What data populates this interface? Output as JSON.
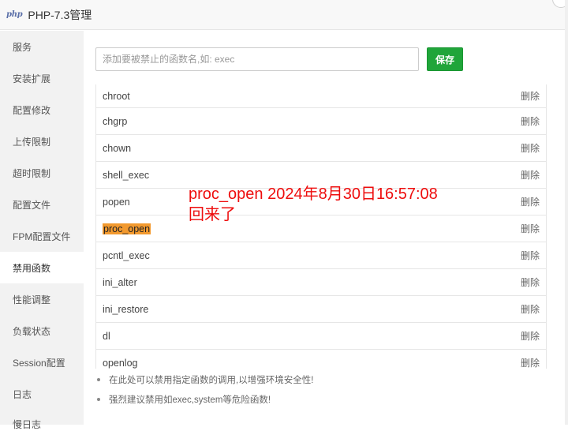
{
  "window": {
    "logo": "php",
    "title": "PHP-7.3管理"
  },
  "sidebar": {
    "items": [
      {
        "label": "服务"
      },
      {
        "label": "安装扩展"
      },
      {
        "label": "配置修改"
      },
      {
        "label": "上传限制"
      },
      {
        "label": "超时限制"
      },
      {
        "label": "配置文件"
      },
      {
        "label": "FPM配置文件"
      },
      {
        "label": "禁用函数",
        "active": true
      },
      {
        "label": "性能调整"
      },
      {
        "label": "负载状态"
      },
      {
        "label": "Session配置"
      },
      {
        "label": "日志"
      },
      {
        "label": "慢日志"
      }
    ]
  },
  "form": {
    "placeholder": "添加要被禁止的函数名,如: exec",
    "value": "",
    "save_label": "保存"
  },
  "functions": {
    "delete_label": "删除",
    "rows": [
      {
        "name": "chroot"
      },
      {
        "name": "chgrp"
      },
      {
        "name": "chown"
      },
      {
        "name": "shell_exec"
      },
      {
        "name": "popen"
      },
      {
        "name": "proc_open",
        "highlighted": true
      },
      {
        "name": "pcntl_exec"
      },
      {
        "name": "ini_alter"
      },
      {
        "name": "ini_restore"
      },
      {
        "name": "dl"
      },
      {
        "name": "openlog"
      }
    ]
  },
  "tips": [
    "在此处可以禁用指定函数的调用,以增强环境安全性!",
    "强烈建议禁用如exec,system等危险函数!"
  ],
  "annotation": {
    "line1": "proc_open 2024年8月30日16:57:08",
    "line2": "回来了"
  },
  "colors": {
    "accent": "#20a53a",
    "highlight": "#f2992e",
    "annotation": "#ee0d0d"
  }
}
